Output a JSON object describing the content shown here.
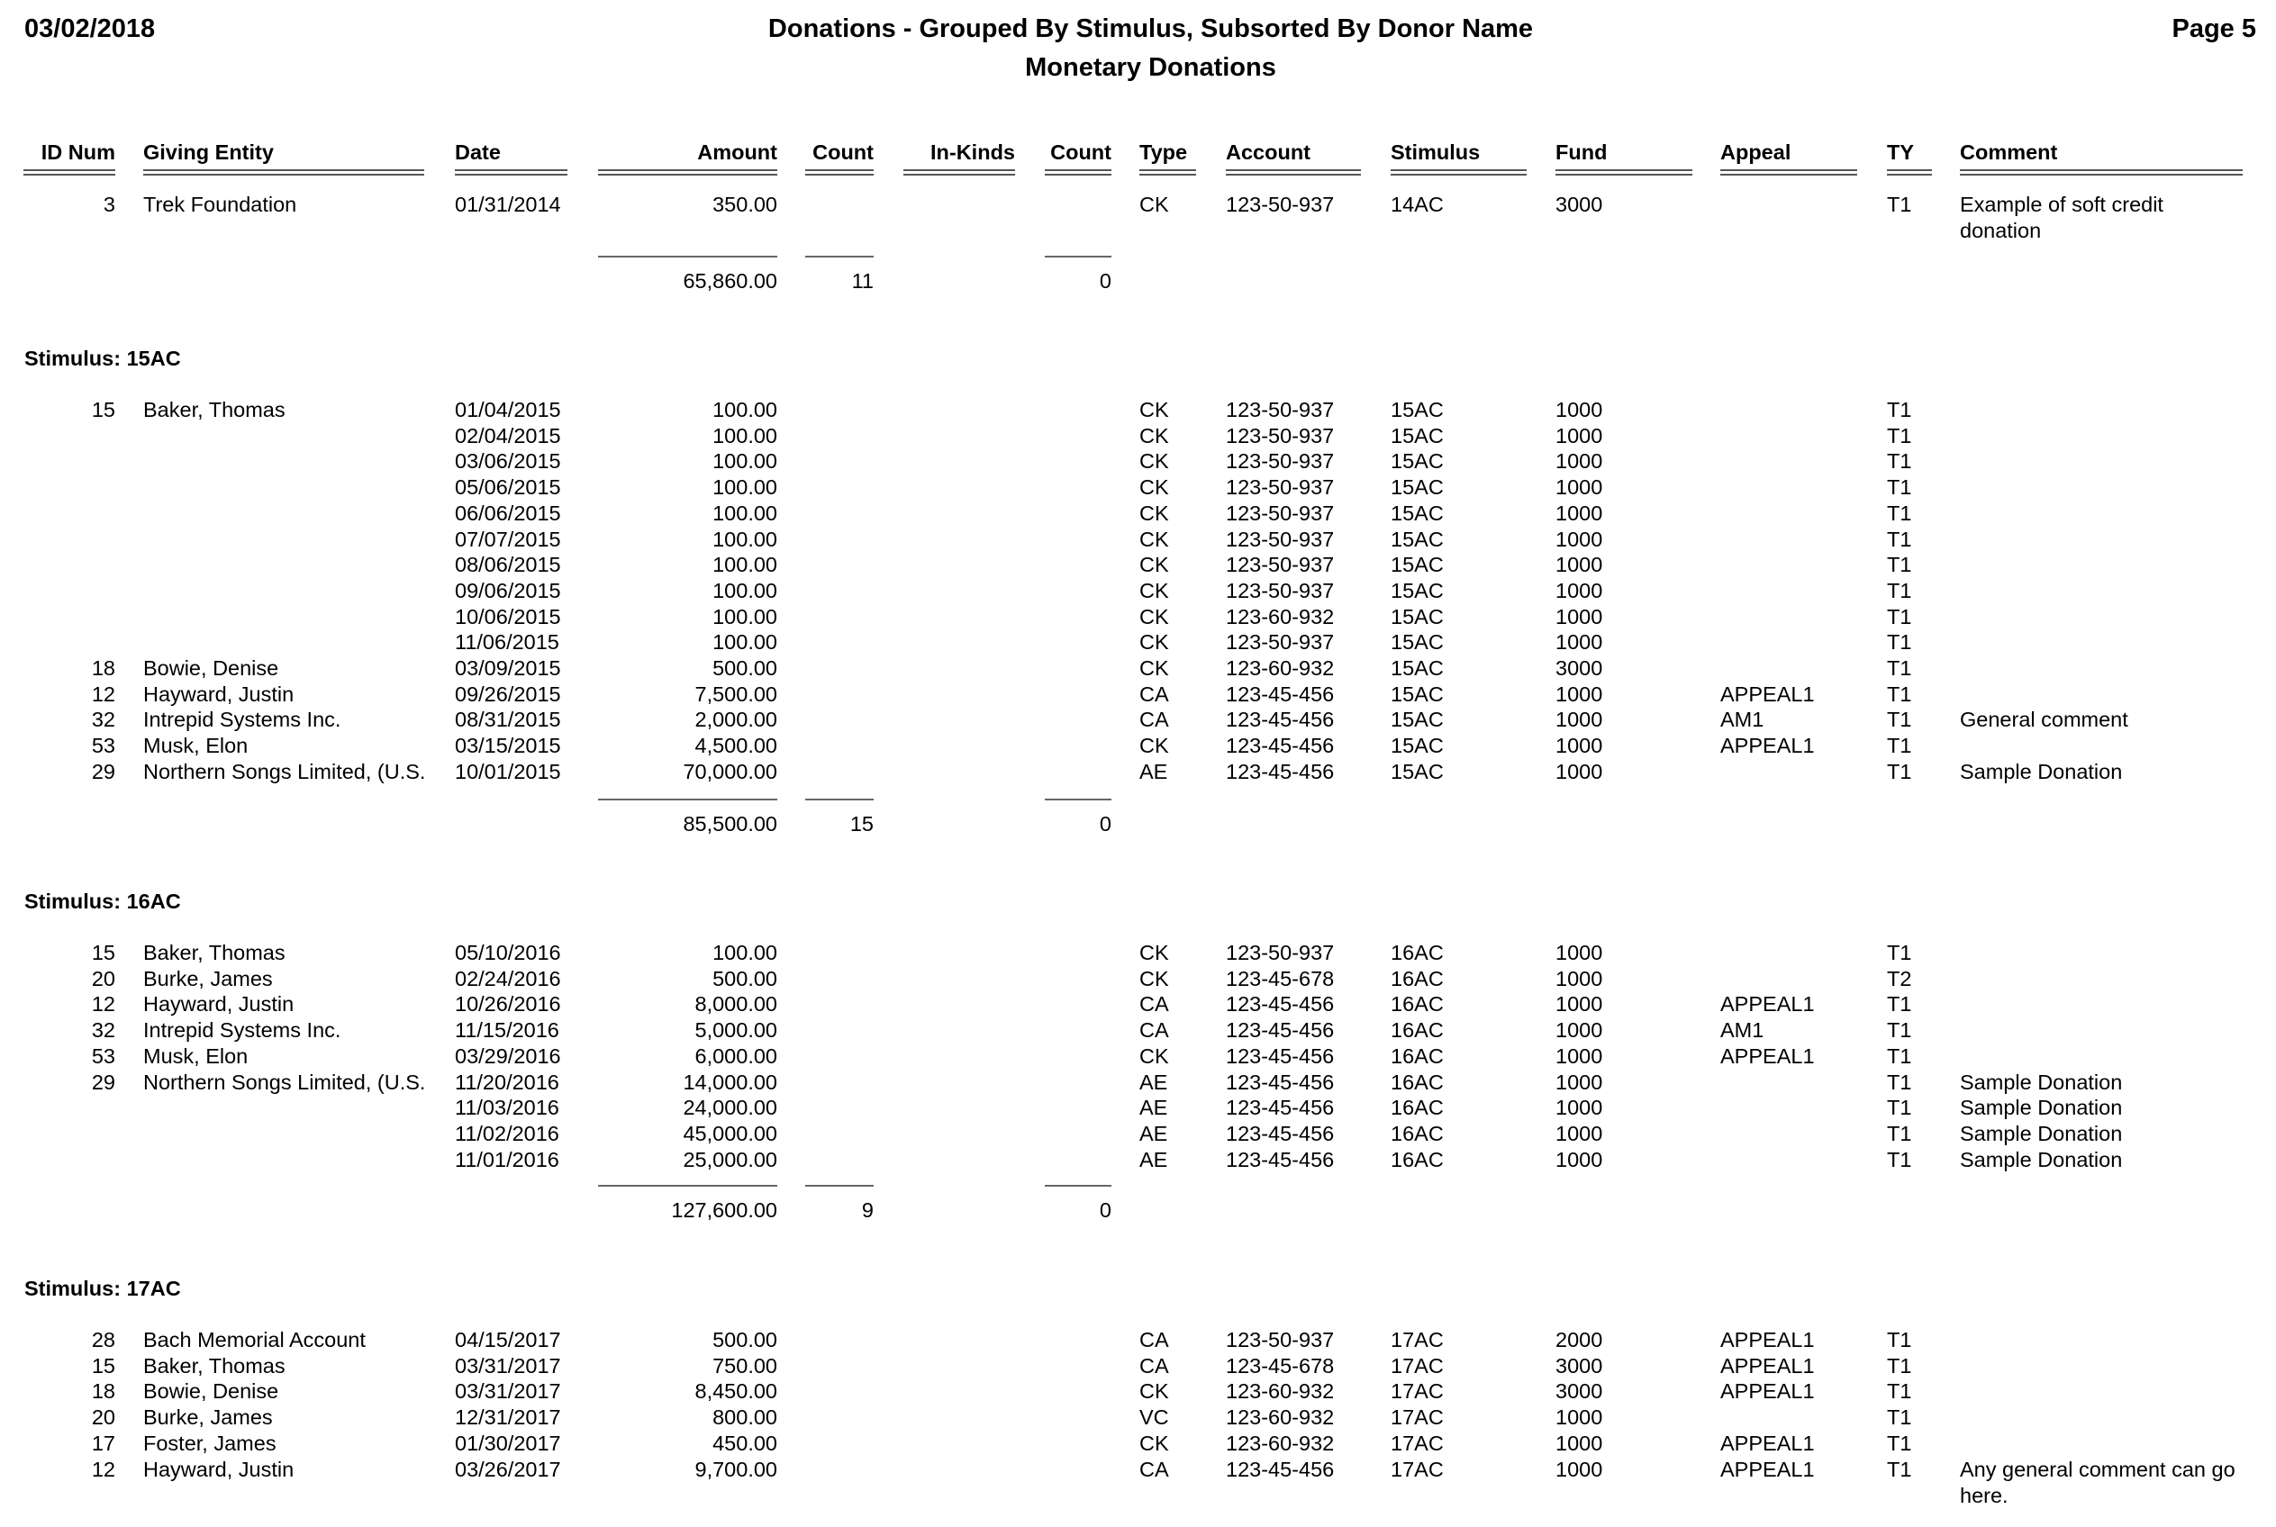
{
  "header": {
    "date": "03/02/2018",
    "title": "Donations - Grouped By Stimulus, Subsorted By Donor Name",
    "subtitle": "Monetary Donations",
    "page": "Page 5"
  },
  "columns": {
    "id": "ID Num",
    "entity": "Giving Entity",
    "date": "Date",
    "amount": "Amount",
    "count": "Count",
    "inkinds": "In-Kinds",
    "count2": "Count",
    "type": "Type",
    "account": "Account",
    "stimulus": "Stimulus",
    "fund": "Fund",
    "appeal": "Appeal",
    "ty": "TY",
    "comment": "Comment"
  },
  "groups": [
    {
      "label": "",
      "rows": [
        {
          "id": "3",
          "entity": "Trek Foundation",
          "date": "01/31/2014",
          "amount": "350.00",
          "type": "CK",
          "account": "123-50-937",
          "stimulus": "14AC",
          "fund": "3000",
          "appeal": "",
          "ty": "T1",
          "comment": "Example of soft credit donation"
        }
      ],
      "totals": {
        "amount": "65,860.00",
        "count": "11",
        "count2": "0"
      }
    },
    {
      "label": "Stimulus: 15AC",
      "rows": [
        {
          "id": "15",
          "entity": "Baker, Thomas",
          "date": "01/04/2015",
          "amount": "100.00",
          "type": "CK",
          "account": "123-50-937",
          "stimulus": "15AC",
          "fund": "1000",
          "appeal": "",
          "ty": "T1",
          "comment": ""
        },
        {
          "id": "",
          "entity": "",
          "date": "02/04/2015",
          "amount": "100.00",
          "type": "CK",
          "account": "123-50-937",
          "stimulus": "15AC",
          "fund": "1000",
          "appeal": "",
          "ty": "T1",
          "comment": ""
        },
        {
          "id": "",
          "entity": "",
          "date": "03/06/2015",
          "amount": "100.00",
          "type": "CK",
          "account": "123-50-937",
          "stimulus": "15AC",
          "fund": "1000",
          "appeal": "",
          "ty": "T1",
          "comment": ""
        },
        {
          "id": "",
          "entity": "",
          "date": "05/06/2015",
          "amount": "100.00",
          "type": "CK",
          "account": "123-50-937",
          "stimulus": "15AC",
          "fund": "1000",
          "appeal": "",
          "ty": "T1",
          "comment": ""
        },
        {
          "id": "",
          "entity": "",
          "date": "06/06/2015",
          "amount": "100.00",
          "type": "CK",
          "account": "123-50-937",
          "stimulus": "15AC",
          "fund": "1000",
          "appeal": "",
          "ty": "T1",
          "comment": ""
        },
        {
          "id": "",
          "entity": "",
          "date": "07/07/2015",
          "amount": "100.00",
          "type": "CK",
          "account": "123-50-937",
          "stimulus": "15AC",
          "fund": "1000",
          "appeal": "",
          "ty": "T1",
          "comment": ""
        },
        {
          "id": "",
          "entity": "",
          "date": "08/06/2015",
          "amount": "100.00",
          "type": "CK",
          "account": "123-50-937",
          "stimulus": "15AC",
          "fund": "1000",
          "appeal": "",
          "ty": "T1",
          "comment": ""
        },
        {
          "id": "",
          "entity": "",
          "date": "09/06/2015",
          "amount": "100.00",
          "type": "CK",
          "account": "123-50-937",
          "stimulus": "15AC",
          "fund": "1000",
          "appeal": "",
          "ty": "T1",
          "comment": ""
        },
        {
          "id": "",
          "entity": "",
          "date": "10/06/2015",
          "amount": "100.00",
          "type": "CK",
          "account": "123-60-932",
          "stimulus": "15AC",
          "fund": "1000",
          "appeal": "",
          "ty": "T1",
          "comment": ""
        },
        {
          "id": "",
          "entity": "",
          "date": "11/06/2015",
          "amount": "100.00",
          "type": "CK",
          "account": "123-50-937",
          "stimulus": "15AC",
          "fund": "1000",
          "appeal": "",
          "ty": "T1",
          "comment": ""
        },
        {
          "id": "18",
          "entity": "Bowie, Denise",
          "date": "03/09/2015",
          "amount": "500.00",
          "type": "CK",
          "account": "123-60-932",
          "stimulus": "15AC",
          "fund": "3000",
          "appeal": "",
          "ty": "T1",
          "comment": ""
        },
        {
          "id": "12",
          "entity": "Hayward, Justin",
          "date": "09/26/2015",
          "amount": "7,500.00",
          "type": "CA",
          "account": "123-45-456",
          "stimulus": "15AC",
          "fund": "1000",
          "appeal": "APPEAL1",
          "ty": "T1",
          "comment": ""
        },
        {
          "id": "32",
          "entity": "Intrepid Systems Inc.",
          "date": "08/31/2015",
          "amount": "2,000.00",
          "type": "CA",
          "account": "123-45-456",
          "stimulus": "15AC",
          "fund": "1000",
          "appeal": "AM1",
          "ty": "T1",
          "comment": "General comment"
        },
        {
          "id": "53",
          "entity": "Musk, Elon",
          "date": "03/15/2015",
          "amount": "4,500.00",
          "type": "CK",
          "account": "123-45-456",
          "stimulus": "15AC",
          "fund": "1000",
          "appeal": "APPEAL1",
          "ty": "T1",
          "comment": ""
        },
        {
          "id": "29",
          "entity": "Northern Songs Limited, (U.S.",
          "date": "10/01/2015",
          "amount": "70,000.00",
          "type": "AE",
          "account": "123-45-456",
          "stimulus": "15AC",
          "fund": "1000",
          "appeal": "",
          "ty": "T1",
          "comment": "Sample Donation"
        }
      ],
      "totals": {
        "amount": "85,500.00",
        "count": "15",
        "count2": "0"
      }
    },
    {
      "label": "Stimulus: 16AC",
      "rows": [
        {
          "id": "15",
          "entity": "Baker, Thomas",
          "date": "05/10/2016",
          "amount": "100.00",
          "type": "CK",
          "account": "123-50-937",
          "stimulus": "16AC",
          "fund": "1000",
          "appeal": "",
          "ty": "T1",
          "comment": ""
        },
        {
          "id": "20",
          "entity": "Burke, James",
          "date": "02/24/2016",
          "amount": "500.00",
          "type": "CK",
          "account": "123-45-678",
          "stimulus": "16AC",
          "fund": "1000",
          "appeal": "",
          "ty": "T2",
          "comment": ""
        },
        {
          "id": "12",
          "entity": "Hayward, Justin",
          "date": "10/26/2016",
          "amount": "8,000.00",
          "type": "CA",
          "account": "123-45-456",
          "stimulus": "16AC",
          "fund": "1000",
          "appeal": "APPEAL1",
          "ty": "T1",
          "comment": ""
        },
        {
          "id": "32",
          "entity": "Intrepid Systems Inc.",
          "date": "11/15/2016",
          "amount": "5,000.00",
          "type": "CA",
          "account": "123-45-456",
          "stimulus": "16AC",
          "fund": "1000",
          "appeal": "AM1",
          "ty": "T1",
          "comment": ""
        },
        {
          "id": "53",
          "entity": "Musk, Elon",
          "date": "03/29/2016",
          "amount": "6,000.00",
          "type": "CK",
          "account": "123-45-456",
          "stimulus": "16AC",
          "fund": "1000",
          "appeal": "APPEAL1",
          "ty": "T1",
          "comment": ""
        },
        {
          "id": "29",
          "entity": "Northern Songs Limited, (U.S.",
          "date": "11/20/2016",
          "amount": "14,000.00",
          "type": "AE",
          "account": "123-45-456",
          "stimulus": "16AC",
          "fund": "1000",
          "appeal": "",
          "ty": "T1",
          "comment": "Sample Donation"
        },
        {
          "id": "",
          "entity": "",
          "date": "11/03/2016",
          "amount": "24,000.00",
          "type": "AE",
          "account": "123-45-456",
          "stimulus": "16AC",
          "fund": "1000",
          "appeal": "",
          "ty": "T1",
          "comment": "Sample Donation"
        },
        {
          "id": "",
          "entity": "",
          "date": "11/02/2016",
          "amount": "45,000.00",
          "type": "AE",
          "account": "123-45-456",
          "stimulus": "16AC",
          "fund": "1000",
          "appeal": "",
          "ty": "T1",
          "comment": "Sample Donation"
        },
        {
          "id": "",
          "entity": "",
          "date": "11/01/2016",
          "amount": "25,000.00",
          "type": "AE",
          "account": "123-45-456",
          "stimulus": "16AC",
          "fund": "1000",
          "appeal": "",
          "ty": "T1",
          "comment": "Sample Donation"
        }
      ],
      "totals": {
        "amount": "127,600.00",
        "count": "9",
        "count2": "0"
      }
    },
    {
      "label": "Stimulus: 17AC",
      "rows": [
        {
          "id": "28",
          "entity": "Bach Memorial Account",
          "date": "04/15/2017",
          "amount": "500.00",
          "type": "CA",
          "account": "123-50-937",
          "stimulus": "17AC",
          "fund": "2000",
          "appeal": "APPEAL1",
          "ty": "T1",
          "comment": ""
        },
        {
          "id": "15",
          "entity": "Baker, Thomas",
          "date": "03/31/2017",
          "amount": "750.00",
          "type": "CA",
          "account": "123-45-678",
          "stimulus": "17AC",
          "fund": "3000",
          "appeal": "APPEAL1",
          "ty": "T1",
          "comment": ""
        },
        {
          "id": "18",
          "entity": "Bowie, Denise",
          "date": "03/31/2017",
          "amount": "8,450.00",
          "type": "CK",
          "account": "123-60-932",
          "stimulus": "17AC",
          "fund": "3000",
          "appeal": "APPEAL1",
          "ty": "T1",
          "comment": ""
        },
        {
          "id": "20",
          "entity": "Burke, James",
          "date": "12/31/2017",
          "amount": "800.00",
          "type": "VC",
          "account": "123-60-932",
          "stimulus": "17AC",
          "fund": "1000",
          "appeal": "",
          "ty": "T1",
          "comment": ""
        },
        {
          "id": "17",
          "entity": "Foster, James",
          "date": "01/30/2017",
          "amount": "450.00",
          "type": "CK",
          "account": "123-60-932",
          "stimulus": "17AC",
          "fund": "1000",
          "appeal": "APPEAL1",
          "ty": "T1",
          "comment": ""
        },
        {
          "id": "12",
          "entity": "Hayward, Justin",
          "date": "03/26/2017",
          "amount": "9,700.00",
          "type": "CA",
          "account": "123-45-456",
          "stimulus": "17AC",
          "fund": "1000",
          "appeal": "APPEAL1",
          "ty": "T1",
          "comment": "Any general comment can go here."
        }
      ]
    }
  ]
}
